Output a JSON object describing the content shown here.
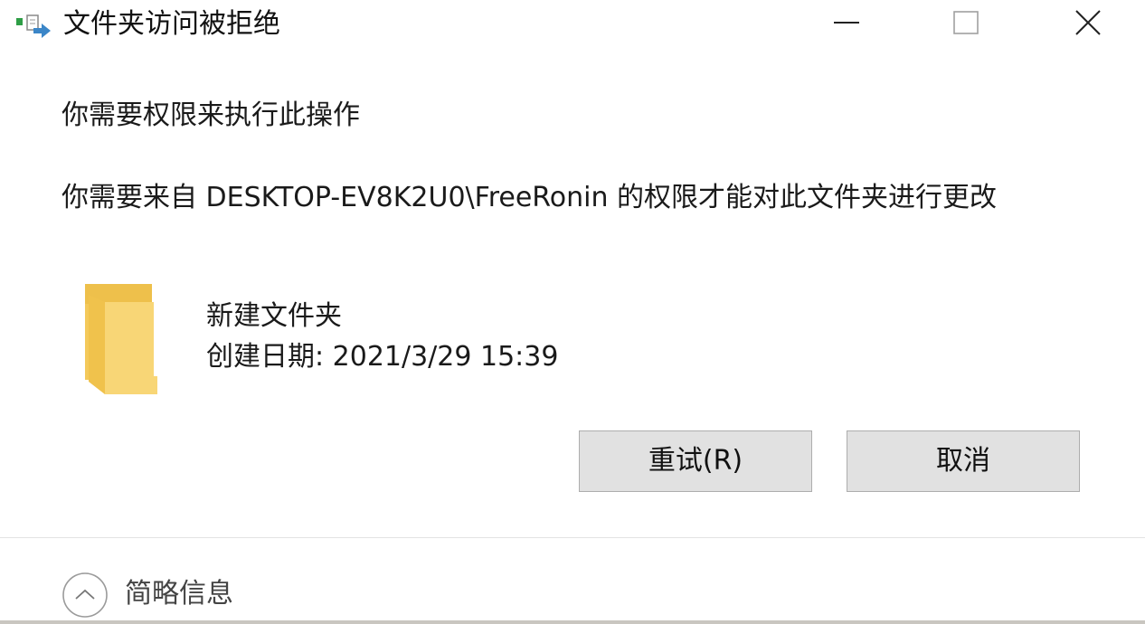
{
  "window": {
    "title": "文件夹访问被拒绝",
    "icon": "folder-move-icon",
    "controls": {
      "minimize": "minimize-icon",
      "maximize": "maximize-icon",
      "close": "close-icon"
    }
  },
  "dialog": {
    "heading": "你需要权限来执行此操作",
    "message": "你需要来自 DESKTOP-EV8K2U0\\FreeRonin 的权限才能对此文件夹进行更改",
    "item": {
      "icon": "folder-icon",
      "name": "新建文件夹",
      "date": "创建日期: 2021/3/29 15:39"
    },
    "buttons": {
      "retry": "重试(R)",
      "cancel": "取消"
    }
  },
  "footer": {
    "expander_icon": "chevron-up-icon",
    "details_label": "简略信息"
  },
  "colors": {
    "background": "#ffffff",
    "button_face": "#e1e1e1",
    "button_border": "#adadad",
    "folder_yellow": "#f8d676",
    "arrow_blue": "#3b86c8",
    "green_mark": "#2e9e46"
  }
}
